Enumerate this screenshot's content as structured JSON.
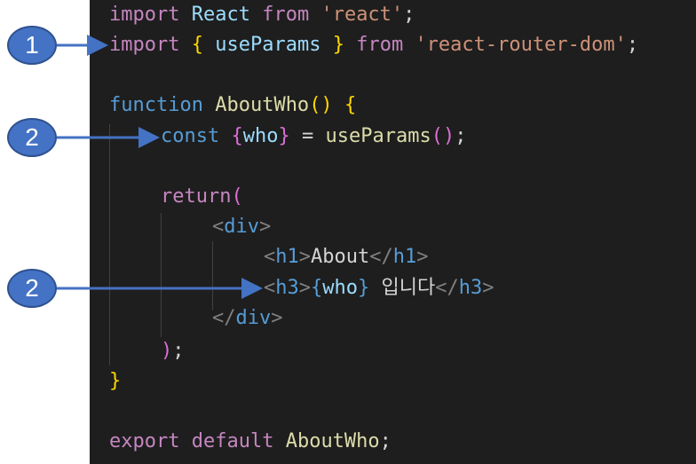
{
  "code": {
    "line1": {
      "import": "import",
      "react": "React",
      "from": "from",
      "str": "'react'",
      "semi": ";"
    },
    "line2": {
      "import": "import",
      "lbrace": "{",
      "name": "useParams",
      "rbrace": "}",
      "from": "from",
      "str": "'react-router-dom'",
      "semi": ";"
    },
    "line4": {
      "function": "function",
      "name": "AboutWho",
      "parens": "()",
      "brace": "{"
    },
    "line5": {
      "const": "const",
      "lbrace": "{",
      "who": "who",
      "rbrace": "}",
      "eq": "=",
      "call": "useParams",
      "parens": "()",
      "semi": ";"
    },
    "line7": {
      "return": "return",
      "paren": "("
    },
    "line8": {
      "lt": "<",
      "tag": "div",
      "gt": ">"
    },
    "line9": {
      "lt": "<",
      "tag": "h1",
      "gt": ">",
      "text": "About",
      "close_lt": "</",
      "close_tag": "h1",
      "close_gt": ">"
    },
    "line10": {
      "lt": "<",
      "tag": "h3",
      "gt": ">",
      "lbrace": "{",
      "who": "who",
      "rbrace": "}",
      "text": "입니다",
      "close_lt": "</",
      "close_tag": "h3",
      "close_gt": ">"
    },
    "line11": {
      "close_lt": "</",
      "tag": "div",
      "gt": ">"
    },
    "line12": {
      "paren": ")",
      "semi": ";"
    },
    "line13": {
      "brace": "}"
    },
    "line15": {
      "export": "export",
      "default": "default",
      "name": "AboutWho",
      "semi": ";"
    }
  },
  "callouts": [
    {
      "number": "1"
    },
    {
      "number": "2"
    },
    {
      "number": "2"
    }
  ],
  "colors": {
    "editor_background": "#1e1e1e",
    "callout_fill": "#4472c4",
    "arrow": "#4472c4"
  }
}
